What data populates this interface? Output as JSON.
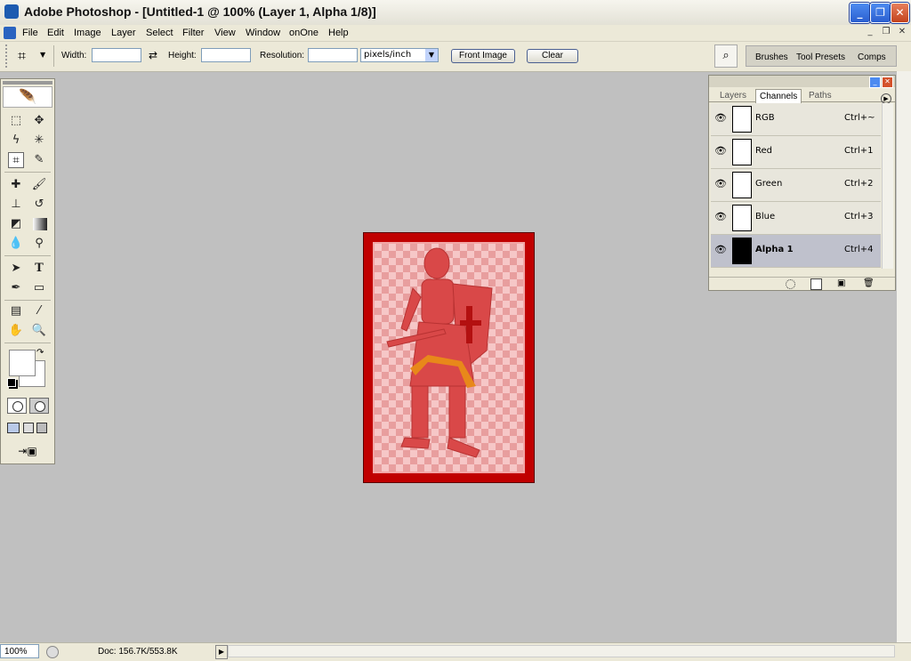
{
  "window": {
    "title": "Adobe Photoshop - [Untitled-1 @ 100% (Layer 1, Alpha 1/8)]"
  },
  "menu": {
    "items": [
      "File",
      "Edit",
      "Image",
      "Layer",
      "Select",
      "Filter",
      "View",
      "Window",
      "onOne",
      "Help"
    ]
  },
  "options": {
    "width_label": "Width:",
    "width_value": "",
    "height_label": "Height:",
    "height_value": "",
    "resolution_label": "Resolution:",
    "resolution_value": "",
    "units": "pixels/inch",
    "front_image_label": "Front Image",
    "clear_label": "Clear"
  },
  "well_tabs": [
    "Brushes",
    "Tool Presets",
    "Comps"
  ],
  "channels_panel": {
    "tabs": [
      "Layers",
      "Channels",
      "Paths"
    ],
    "active_tab": "Channels",
    "rows": [
      {
        "name": "RGB",
        "shortcut": "Ctrl+~",
        "visible": true,
        "selected": false
      },
      {
        "name": "Red",
        "shortcut": "Ctrl+1",
        "visible": true,
        "selected": false
      },
      {
        "name": "Green",
        "shortcut": "Ctrl+2",
        "visible": true,
        "selected": false
      },
      {
        "name": "Blue",
        "shortcut": "Ctrl+3",
        "visible": true,
        "selected": false
      },
      {
        "name": "Alpha 1",
        "shortcut": "Ctrl+4",
        "visible": true,
        "selected": true
      }
    ]
  },
  "status": {
    "zoom": "100%",
    "doc": "Doc: 156.7K/553.8K"
  },
  "colors": {
    "canvas_bg": "#c0c0c0",
    "quickmask_red": "#c00000",
    "chrome": "#ece9d8"
  }
}
